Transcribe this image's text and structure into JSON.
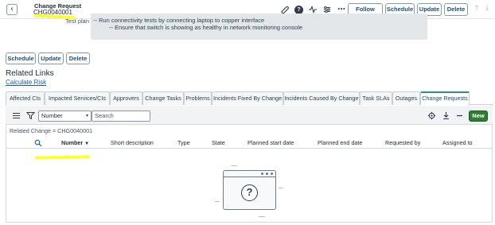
{
  "header": {
    "title": "Change Request",
    "record_number": "CHG0040001",
    "back_icon": "chevron-left-icon",
    "icons": [
      "paperclip-icon",
      "help-icon",
      "activity-icon",
      "settings-icon",
      "more-icon"
    ],
    "buttons": {
      "follow": "Follow",
      "schedule": "Schedule",
      "update": "Update",
      "delete": "Delete"
    }
  },
  "form": {
    "test_plan_label": "Test plan",
    "test_plan_lines": [
      "-- Run connectivity tests by connecting laptop to copper interface",
      "-- Ensure that switch is showing as healthy in network monitoring console"
    ],
    "bottom_buttons": {
      "schedule": "Schedule",
      "update": "Update",
      "delete": "Delete"
    }
  },
  "related_links": {
    "title": "Related Links",
    "calculate_risk": "Calculate Risk"
  },
  "tabs": [
    {
      "label": "Affected CIs"
    },
    {
      "label": "Impacted Services/CIs"
    },
    {
      "label": "Approvers"
    },
    {
      "label": "Change Tasks"
    },
    {
      "label": "Problems"
    },
    {
      "label": "Incidents Fixed By Change"
    },
    {
      "label": "Incidents Caused By Change"
    },
    {
      "label": "Task SLAs"
    },
    {
      "label": "Outages"
    },
    {
      "label": "Change Requests",
      "active": true
    }
  ],
  "list": {
    "search_field_select": "Number",
    "search_placeholder": "Search",
    "new_button": "New",
    "filter_breadcrumb": "Related Change = CHG0040001",
    "columns": [
      "Number",
      "Short description",
      "Type",
      "State",
      "Planned start date",
      "Planned end date",
      "Requested by",
      "Assigned to"
    ],
    "sort_indicator": "▼",
    "rows": []
  },
  "colors": {
    "active_tab_accent": "#2f8f7a",
    "new_button": "#2e7d32",
    "highlight_marker": "#ffff3a",
    "link": "#1f5c99"
  }
}
